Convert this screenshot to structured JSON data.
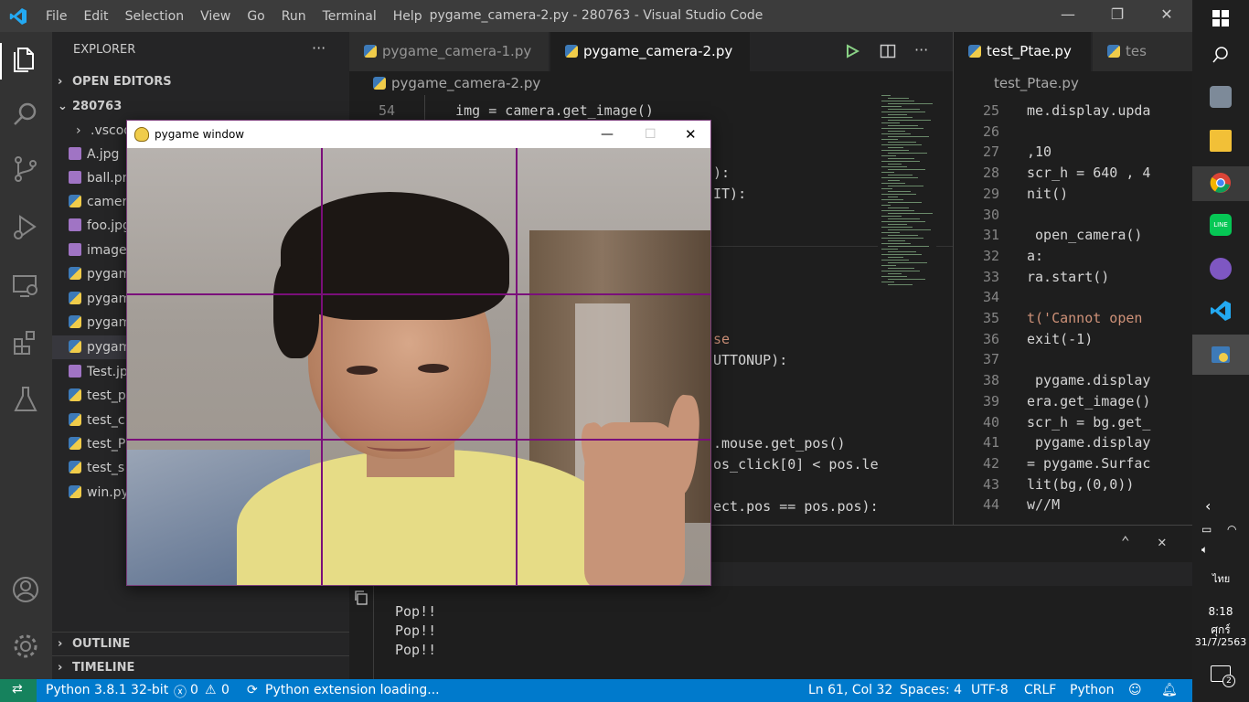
{
  "window": {
    "title": "pygame_camera-2.py - 280763 - Visual Studio Code",
    "menu": [
      "File",
      "Edit",
      "Selection",
      "View",
      "Go",
      "Run",
      "Terminal",
      "Help"
    ]
  },
  "explorer": {
    "header": "EXPLORER",
    "more": "···",
    "open_editors": "OPEN EDITORS",
    "folder": "280763",
    "items": [
      ".vscode",
      "A.jpg",
      "ball.pn",
      "camera",
      "foo.jpg",
      "image",
      "pygam",
      "pygam",
      "pygam",
      "pygam",
      "Test.jpg",
      "test_p",
      "test_c",
      "test_P",
      "test_s",
      "win.py"
    ],
    "outline": "OUTLINE",
    "timeline": "TIMELINE"
  },
  "editor": {
    "tabs": [
      "pygame_camera-1.py",
      "pygame_camera-2.py"
    ],
    "breadcrumb": "pygame_camera-2.py",
    "lines": [
      {
        "n": "54",
        "text": "    img = camera.get_image()"
      }
    ],
    "fragments": [
      "):",
      "IT):",
      "se",
      "UTTONUP):",
      ".mouse.get_pos()",
      "os_click[0] < pos.le",
      "ect.pos == pos.pos):"
    ]
  },
  "right_editor": {
    "tabs": [
      "test_Ptae.py",
      "tes"
    ],
    "breadcrumb": "test_Ptae.py",
    "lines": [
      {
        "n": "25",
        "text": "me.display.upda"
      },
      {
        "n": "26",
        "text": ""
      },
      {
        "n": "27",
        "text": ",10"
      },
      {
        "n": "28",
        "text": "scr_h = 640 , 4"
      },
      {
        "n": "29",
        "text": "nit()"
      },
      {
        "n": "30",
        "text": ""
      },
      {
        "n": "31",
        "text": " open_camera()"
      },
      {
        "n": "32",
        "text": "a:"
      },
      {
        "n": "33",
        "text": "ra.start()"
      },
      {
        "n": "34",
        "text": ""
      },
      {
        "n": "35",
        "text": "t('Cannot open "
      },
      {
        "n": "36",
        "text": "exit(-1)"
      },
      {
        "n": "37",
        "text": ""
      },
      {
        "n": "38",
        "text": " pygame.display"
      },
      {
        "n": "39",
        "text": "era.get_image()"
      },
      {
        "n": "40",
        "text": "scr_h = bg.get_"
      },
      {
        "n": "41",
        "text": " pygame.display"
      },
      {
        "n": "42",
        "text": "= pygame.Surfac"
      },
      {
        "n": "43",
        "text": "lit(bg,(0,0))"
      },
      {
        "n": "44",
        "text": "w//M"
      }
    ]
  },
  "terminal": {
    "output": [
      "Pop!!",
      "Pop!!",
      "Pop!!"
    ]
  },
  "statusbar": {
    "python": "Python 3.8.1 32-bit",
    "errors": "0",
    "warnings": "0",
    "loading": "Python extension loading...",
    "position": "Ln 61, Col 32",
    "spaces": "Spaces: 4",
    "encoding": "UTF-8",
    "eol": "CRLF",
    "language": "Python"
  },
  "pygame": {
    "title": "pygame window"
  },
  "taskbar": {
    "lang": "ไทย",
    "time": "8:18",
    "day": "ศุกร์",
    "date": "31/7/2563",
    "notif": "2"
  },
  "colors": {
    "accent": "#007acc",
    "grid": "#7a0f7a"
  }
}
